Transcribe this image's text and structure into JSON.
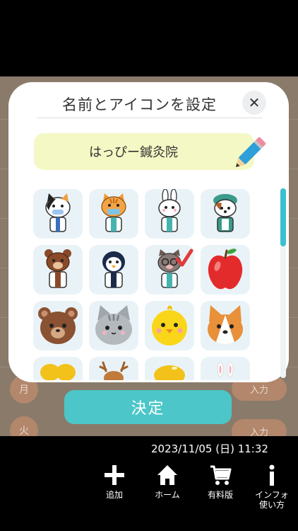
{
  "background": {
    "day_labels": [
      "月",
      "火"
    ],
    "input_labels": [
      "入力",
      "入力"
    ]
  },
  "dialog": {
    "title": "名前とアイコンを設定",
    "close_icon": "close-icon",
    "name_value": "はっぴー鍼灸院",
    "pencil_icon": "pencil-icon",
    "icons": [
      "calico-cat-doctor",
      "orange-cat-doctor",
      "white-rabbit-doctor",
      "shiba-dog-nurse",
      "bear-doctor",
      "penguin-doctor",
      "pig-doctor-selected",
      "red-apple",
      "bear-face",
      "gray-cat-face",
      "yellow-chick-face",
      "corgi-face",
      "yellow-item",
      "deer-item",
      "bread-item",
      "white-rabbit-item"
    ],
    "selected_icon": "pig-doctor-selected",
    "confirm_label": "決定",
    "accent": "#4cc6c8"
  },
  "status": {
    "datetime": "2023/11/05 (日) 11:32"
  },
  "nav": {
    "items": [
      {
        "label": "追加",
        "icon": "plus-icon"
      },
      {
        "label": "ホーム",
        "icon": "home-icon"
      },
      {
        "label": "有料版",
        "icon": "cart-icon"
      },
      {
        "label": "インフォ\n使い方",
        "icon": "info-icon"
      }
    ]
  }
}
